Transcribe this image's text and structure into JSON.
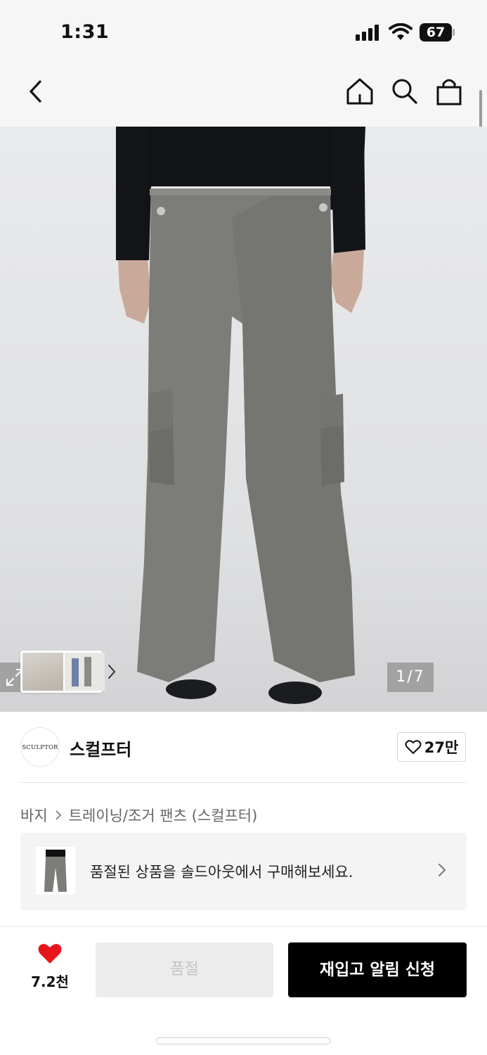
{
  "status_bar": {
    "time": "1:31",
    "battery": "67"
  },
  "header": {
    "back_icon": "chevron-left-icon",
    "home_icon": "home-icon",
    "search_icon": "search-icon",
    "bag_icon": "shopping-bag-icon"
  },
  "gallery": {
    "counter": "1/7",
    "expand_icon": "expand-icon"
  },
  "brand": {
    "logo_text": "SCULPTOR",
    "name": "스컬프터",
    "likes": "27만"
  },
  "breadcrumb": {
    "items": [
      "바지",
      "트레이닝/조거 팬츠 (스컬프터)"
    ]
  },
  "soldout_banner": {
    "text": "품절된 상품을 솔드아웃에서 구매해보세요."
  },
  "bottom_bar": {
    "wish_count": "7.2천",
    "soldout_label": "품절",
    "restock_label": "재입고 알림 신청"
  },
  "colors": {
    "primary": "#000000",
    "heart": "#e8141c",
    "disabled_bg": "#ececec",
    "disabled_text": "#c4c4c4"
  }
}
